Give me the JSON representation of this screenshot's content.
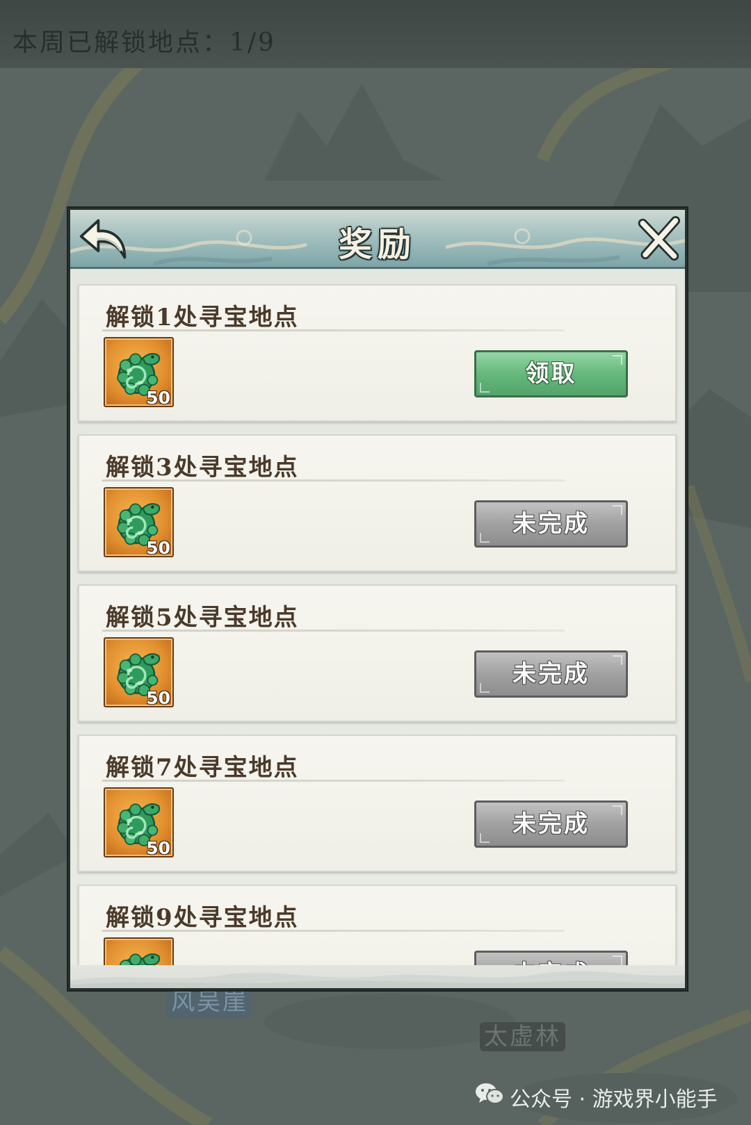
{
  "top_bar": {
    "unlocked_label": "本周已解锁地点：1/9"
  },
  "modal": {
    "title": "奖励"
  },
  "rewards": [
    {
      "title": "解锁1处寻宝地点",
      "item_count": "50",
      "button_label": "领取",
      "state": "claimable"
    },
    {
      "title": "解锁3处寻宝地点",
      "item_count": "50",
      "button_label": "未完成",
      "state": "incomplete"
    },
    {
      "title": "解锁5处寻宝地点",
      "item_count": "50",
      "button_label": "未完成",
      "state": "incomplete"
    },
    {
      "title": "解锁7处寻宝地点",
      "item_count": "50",
      "button_label": "未完成",
      "state": "incomplete"
    },
    {
      "title": "解锁9处寻宝地点",
      "item_count": "",
      "button_label": "未完成",
      "state": "incomplete"
    }
  ],
  "map_labels": {
    "label_1": "风吴崖",
    "label_2": "太虚林"
  },
  "watermark": {
    "text": "公众号 · 游戏界小能手"
  },
  "icons": {
    "back": "back-arrow-icon",
    "close": "close-icon",
    "reward_item": "jade-dragon-icon",
    "watermark": "wechat-icon"
  },
  "colors": {
    "claim_button": "#66b87c",
    "incomplete_button": "#a1a1a1",
    "header": "#a9c4c2",
    "card": "#f4f3ec",
    "item_frame": "#e2902f"
  }
}
